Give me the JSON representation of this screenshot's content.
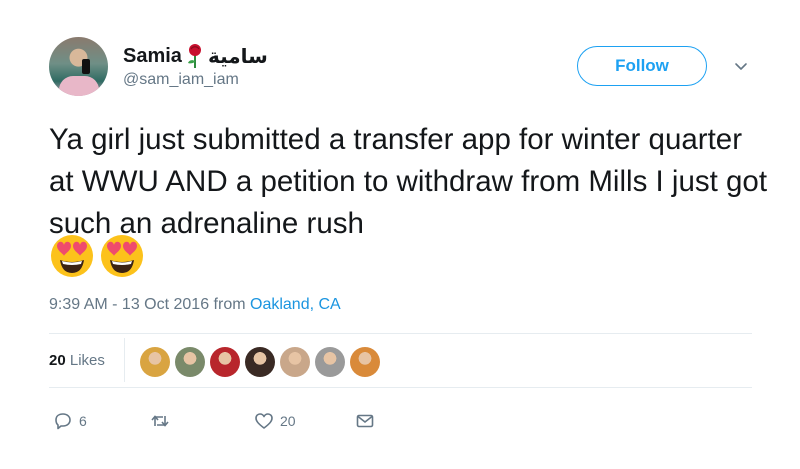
{
  "tweet": {
    "author": {
      "name": "Samia",
      "name_arabic": "سامية",
      "handle": "@sam_iam_iam"
    },
    "follow_label": "Follow",
    "text": "Ya girl just submitted a transfer app for winter quarter at WWU AND a petition to withdraw from Mills I just got such an adrenaline rush",
    "emojis": [
      "heart-eyes-emoji",
      "heart-eyes-emoji"
    ],
    "timestamp": "9:39 AM - 13 Oct 2016",
    "from_word": "from",
    "place": "Oakland, CA",
    "likes": {
      "count": "20",
      "label": "Likes"
    },
    "liker_avatar_colors": [
      "#d9a441",
      "#7a8a6a",
      "#b8262c",
      "#3a2a24",
      "#c9a78a",
      "#9a9a9a",
      "#d98a3a"
    ],
    "actions": {
      "replies": "6",
      "retweets": "",
      "likes": "20"
    }
  },
  "colors": {
    "accent": "#1da1f2",
    "text": "#14171a",
    "muted": "#657786",
    "divider": "#e6ecf0"
  }
}
